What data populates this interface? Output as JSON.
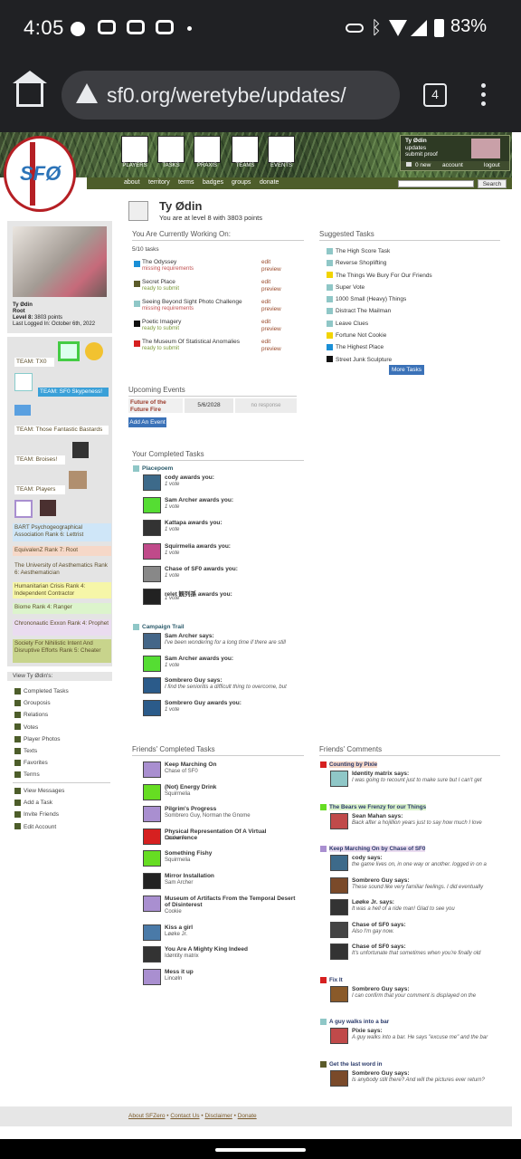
{
  "status": {
    "time": "4:05",
    "battery": "83%"
  },
  "browser": {
    "url": "sf0.org/weretybe/updates/",
    "tab_count": "4"
  },
  "site": {
    "logo": "SFØ",
    "nav": [
      "PLAYERS",
      "TASKS",
      "PRAXIS",
      "TEAMS",
      "EVENTS"
    ],
    "user_box": {
      "name": "Ty Ødin",
      "line1": "updates",
      "line2": "submit proof",
      "new": "0 new",
      "account": "account",
      "logout": "logout"
    },
    "submenu": [
      "about",
      "territory",
      "terms",
      "badges",
      "groups",
      "donate"
    ],
    "search_label": "Search"
  },
  "profile": {
    "name": "Ty Ødin",
    "role": "Root",
    "level": "Level 8:",
    "points": "3803 points",
    "last_login": "Last Logged In: October 6th, 2022"
  },
  "teams": [
    "TEAM: TX0",
    "TEAM: SF0 Skypeness!",
    "TEAM: Those Fantastic Bastards",
    "TEAM: Broises!",
    "TEAM: Players"
  ],
  "ranks": [
    "BART Psychogeographical Association Rank 6: Lettrist",
    "EquivalenZ Rank 7: Root",
    "The University of Aesthematics Rank 6: Aesthematician",
    "Humanitarian Crisis Rank 4: Independent Contractor",
    "Biome Rank 4: Ranger",
    "Chrononautic Exxon Rank 4: Prophet",
    "Society For Nihilistic Intent And Disruptive Efforts Rank 5: Cheater"
  ],
  "view_title": "View Ty Ødin's:",
  "view_links": [
    "Completed Tasks",
    "Grouposis",
    "Relations",
    "Votes",
    "Player Photos",
    "Texts",
    "Favorites",
    "Terms"
  ],
  "account_links": [
    "View Messages",
    "Add a Task",
    "Invite Friends",
    "Edit Account"
  ],
  "header": {
    "name": "Ty Ødin",
    "subtitle": "You are at level 8 with 3803 points"
  },
  "working": {
    "title": "You Are Currently Working On:",
    "count": "5/10 tasks",
    "edit": "edit",
    "preview": "preview",
    "tasks": [
      {
        "name": "The Odyssey",
        "status": "missing requirements",
        "color": "#1a8fd6"
      },
      {
        "name": "Secret Place",
        "status": "ready to submit",
        "color": "#5b5b2a"
      },
      {
        "name": "Seeing Beyond Sight Photo Challenge",
        "status": "missing requirements",
        "color": "#8fc7c7"
      },
      {
        "name": "Poetic Imagery",
        "status": "ready to submit",
        "color": "#111111"
      },
      {
        "name": "The Museum Of Statistical Anomalies",
        "status": "ready to submit",
        "color": "#d62020"
      }
    ]
  },
  "suggested": {
    "title": "Suggested Tasks",
    "more": "More Tasks",
    "tasks": [
      {
        "name": "The High Score Task",
        "color": "#8fc7c7"
      },
      {
        "name": "Reverse Shoplifting",
        "color": "#8fc7c7"
      },
      {
        "name": "The Things We Bury For Our Friends",
        "color": "#f2d400"
      },
      {
        "name": "Super Vote",
        "color": "#8fc7c7"
      },
      {
        "name": "1000 Small (Heavy) Things",
        "color": "#8fc7c7"
      },
      {
        "name": "Distract The Mailman",
        "color": "#8fc7c7"
      },
      {
        "name": "Leave Clues",
        "color": "#8fc7c7"
      },
      {
        "name": "Fortune Not Cookie",
        "color": "#f2d400"
      },
      {
        "name": "The Highest Place",
        "color": "#1a8fd6"
      },
      {
        "name": "Street Junk Sculpture",
        "color": "#111111"
      }
    ]
  },
  "events": {
    "title": "Upcoming Events",
    "name": "Future of the Future Fire",
    "date": "5/6/2028",
    "response": "no response",
    "add": "Add An Event"
  },
  "completed": {
    "title": "Your Completed Tasks",
    "groups": [
      {
        "task": "Placepoem",
        "color": "#8fc7c7",
        "items": [
          {
            "who": "cody awards you:",
            "text": "1 vote"
          },
          {
            "who": "Sam Archer awards you:",
            "text": "1 vote"
          },
          {
            "who": "Kattapa awards you:",
            "text": "1 vote"
          },
          {
            "who": "Squirmelia awards you:",
            "text": "1 vote"
          },
          {
            "who": "Chase of SF0 awards you:",
            "text": "1 vote"
          },
          {
            "who": "relet 観列孫 awards you:",
            "text": "1 vote"
          }
        ]
      },
      {
        "task": "Campaign Trail",
        "color": "#8fc7c7",
        "items": [
          {
            "who": "Sam Archer says:",
            "text": "I've been wondering for a long time if there are still"
          },
          {
            "who": "Sam Archer awards you:",
            "text": "1 vote"
          },
          {
            "who": "Sombrero Guy says:",
            "text": "I find the senioritis a difficult thing to overcome, but"
          },
          {
            "who": "Sombrero Guy awards you:",
            "text": "1 vote"
          }
        ]
      }
    ]
  },
  "friends_completed": {
    "title": "Friends' Completed Tasks",
    "items": [
      {
        "task": "Keep Marching On",
        "who": "Chase of SF0"
      },
      {
        "task": "(Not) Energy Drink",
        "who": "Squirmelia"
      },
      {
        "task": "Pilgrim's Progress",
        "who": "Sombrero Guy, Norman the Gnome"
      },
      {
        "task": "Physical Representation Of A Virtual Occurrence",
        "who": "Løøke Jr."
      },
      {
        "task": "Something Fishy",
        "who": "Squirmelia"
      },
      {
        "task": "Mirror Installation",
        "who": "Sam Archer"
      },
      {
        "task": "Museum of Artifacts From the Temporal Desert of Disinterest",
        "who": "Cookie"
      },
      {
        "task": "Kiss a girl",
        "who": "Løøke Jr."
      },
      {
        "task": "You Are A Mighty King Indeed",
        "who": "Idøntity matrix"
      },
      {
        "task": "Mess it up",
        "who": "Lincøln"
      }
    ]
  },
  "friends_comments": {
    "title": "Friends' Comments",
    "groups": [
      {
        "task": "Counting by Pixie",
        "color": "#d62020",
        "items": [
          {
            "who": "Idøntity matrix says:",
            "text": "I was going to recount just to make sure but I can't get"
          }
        ]
      },
      {
        "task": "The Bears we Frenzy for our Things",
        "color": "#66dd22",
        "items": [
          {
            "who": "Sean Mahan says:",
            "text": "Back after a hojillion years just to say how much I love"
          }
        ]
      },
      {
        "task": "Keep Marching On by Chase of SF0",
        "color": "#a98fd0",
        "items": [
          {
            "who": "cody says:",
            "text": "the game lives on, in one way or another. logged in on a"
          },
          {
            "who": "Sombrero Guy says:",
            "text": "These sound like very familiar feelings. I did eventually"
          },
          {
            "who": "Løøke Jr. says:",
            "text": "It was a hell of a ride man! Glad to see you"
          },
          {
            "who": "Chase of SF0 says:",
            "text": "Also I'm gay now."
          },
          {
            "who": "Chase of SF0 says:",
            "text": "It's unfortunate that sometimes when you're finally old"
          }
        ]
      },
      {
        "task": "Fix It",
        "color": "#d62020",
        "items": [
          {
            "who": "Sombrero Guy says:",
            "text": "I can confirm that your comment is displayed on the"
          }
        ]
      },
      {
        "task": "A guy walks into a bar",
        "color": "#8fc7c7",
        "items": [
          {
            "who": "Pixie says:",
            "text": "A guy walks into a bar. He says \"excuse me\" and the bar"
          }
        ]
      },
      {
        "task": "Get the last word in",
        "color": "#5b5b2a",
        "items": [
          {
            "who": "Sombrero Guy says:",
            "text": "Is anybody still there? And will the pictures ever return?"
          }
        ]
      }
    ]
  },
  "footer": {
    "about": "About SFZero",
    "contact": "Contact Us",
    "disclaimer": "Disclaimer",
    "donate": "Donate",
    "sep": "•"
  }
}
